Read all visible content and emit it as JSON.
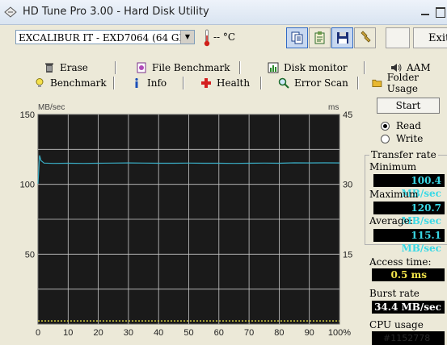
{
  "window": {
    "title": "HD Tune Pro 3.00 - Hard Disk Utility"
  },
  "toolbar": {
    "drive": "EXCALIBUR IT - EXD7064 (64 GB)",
    "temperature": "-- °C",
    "exit_label": "Exit"
  },
  "tabs": {
    "row1": [
      {
        "label": "Erase",
        "icon": "trash-icon"
      },
      {
        "label": "File Benchmark",
        "icon": "file-benchmark-icon"
      },
      {
        "label": "Disk monitor",
        "icon": "disk-monitor-icon"
      },
      {
        "label": "AAM",
        "icon": "speaker-icon"
      }
    ],
    "row2": [
      {
        "label": "Benchmark",
        "icon": "lightbulb-icon",
        "selected": true
      },
      {
        "label": "Info",
        "icon": "info-icon"
      },
      {
        "label": "Health",
        "icon": "health-cross-icon"
      },
      {
        "label": "Error Scan",
        "icon": "magnifier-icon"
      },
      {
        "label": "Folder Usage",
        "icon": "folder-icon"
      }
    ]
  },
  "controls": {
    "start_label": "Start",
    "read_label": "Read",
    "write_label": "Write",
    "selected_mode": "Read"
  },
  "transfer": {
    "group_label": "Transfer rate",
    "minimum_label": "Minimum",
    "minimum_value": "100.4 MB/sec",
    "maximum_label": "Maximum",
    "maximum_value": "120.7 MB/sec",
    "average_label": "Average:",
    "average_value": "115.1 MB/sec"
  },
  "access": {
    "label": "Access time:",
    "value": "0.5 ms"
  },
  "burst": {
    "label": "Burst rate",
    "value": "34.4 MB/sec"
  },
  "cpu": {
    "label": "CPU usage"
  },
  "watermark": "#1152778",
  "colors": {
    "transfer_line": "#3ab0c8",
    "access_points": "#d8d040",
    "chart_bg": "#1a1a1a",
    "grid": "#c8c8c8"
  },
  "chart_data": {
    "type": "line",
    "ylabel_left": "MB/sec",
    "ylabel_right": "ms",
    "y_left_ticks": [
      "150",
      "100",
      "50"
    ],
    "y_right_ticks": [
      "45",
      "30",
      "15"
    ],
    "x_ticks": [
      "0",
      "10",
      "20",
      "30",
      "40",
      "50",
      "60",
      "70",
      "80",
      "90",
      "100%"
    ],
    "ylim_left": [
      0,
      150
    ],
    "ylim_right": [
      0,
      45
    ],
    "xlim": [
      0,
      100
    ],
    "grid": true,
    "series": [
      {
        "name": "transfer",
        "x": [
          0,
          0.5,
          1,
          2,
          5,
          10,
          15,
          20,
          25,
          30,
          35,
          40,
          45,
          50,
          55,
          60,
          65,
          70,
          75,
          80,
          85,
          90,
          95,
          100
        ],
        "y": [
          100.4,
          120.7,
          117,
          115.2,
          115.0,
          115.1,
          115.0,
          115.1,
          115.2,
          115.3,
          115.2,
          115.1,
          115.1,
          115.2,
          115.1,
          115.1,
          115.0,
          115.1,
          115.2,
          115.1,
          115.4,
          115.3,
          115.4,
          115.3
        ]
      },
      {
        "name": "access",
        "x": [
          0,
          10,
          20,
          30,
          40,
          50,
          60,
          70,
          80,
          90,
          100
        ],
        "y": [
          0.5,
          0.5,
          0.5,
          0.5,
          0.5,
          0.5,
          0.5,
          0.5,
          0.5,
          0.5,
          0.5
        ]
      }
    ]
  }
}
